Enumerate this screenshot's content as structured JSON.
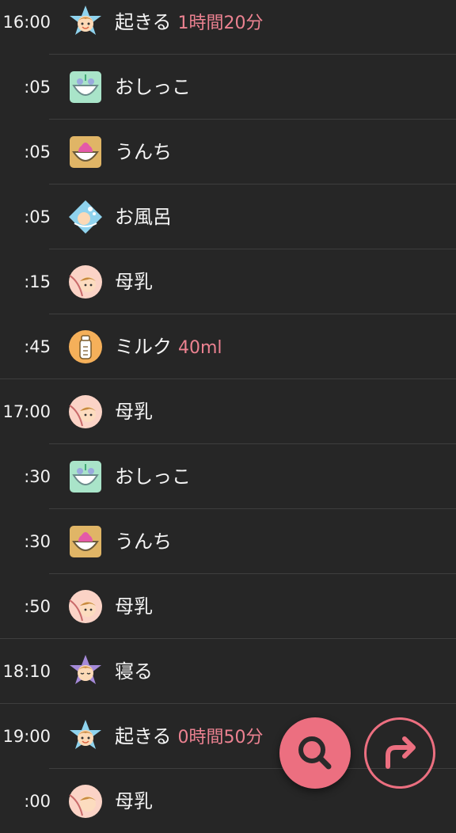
{
  "entries": [
    {
      "time": "16:00",
      "label": "起きる",
      "extra": "1時間20分",
      "icon": "baby-awake-icon",
      "hour_break": true
    },
    {
      "time": ":05",
      "label": "おしっこ",
      "extra": "",
      "icon": "pee-diaper-icon",
      "hour_break": false
    },
    {
      "time": ":05",
      "label": "うんち",
      "extra": "",
      "icon": "poop-diaper-icon",
      "hour_break": false
    },
    {
      "time": ":05",
      "label": "お風呂",
      "extra": "",
      "icon": "bath-icon",
      "hour_break": false
    },
    {
      "time": ":15",
      "label": "母乳",
      "extra": "",
      "icon": "breastfeeding-icon",
      "hour_break": false
    },
    {
      "time": ":45",
      "label": "ミルク",
      "extra": "40ml",
      "icon": "milk-bottle-icon",
      "hour_break": false
    },
    {
      "time": "17:00",
      "label": "母乳",
      "extra": "",
      "icon": "breastfeeding-icon",
      "hour_break": true
    },
    {
      "time": ":30",
      "label": "おしっこ",
      "extra": "",
      "icon": "pee-diaper-icon",
      "hour_break": false
    },
    {
      "time": ":30",
      "label": "うんち",
      "extra": "",
      "icon": "poop-diaper-icon",
      "hour_break": false
    },
    {
      "time": ":50",
      "label": "母乳",
      "extra": "",
      "icon": "breastfeeding-icon",
      "hour_break": false
    },
    {
      "time": "18:10",
      "label": "寝る",
      "extra": "",
      "icon": "baby-sleep-icon",
      "hour_break": true
    },
    {
      "time": "19:00",
      "label": "起きる",
      "extra": "0時間50分",
      "icon": "baby-awake-icon",
      "hour_break": true
    },
    {
      "time": ":00",
      "label": "母乳",
      "extra": "",
      "icon": "breastfeeding-icon",
      "hour_break": false
    }
  ],
  "actions": {
    "search_icon": "search-icon",
    "redo_icon": "redo-arrow-icon"
  },
  "colors": {
    "background": "#262626",
    "accent": "#ec6f80",
    "extra_text": "#ec8291",
    "text": "#f5f5f5"
  }
}
